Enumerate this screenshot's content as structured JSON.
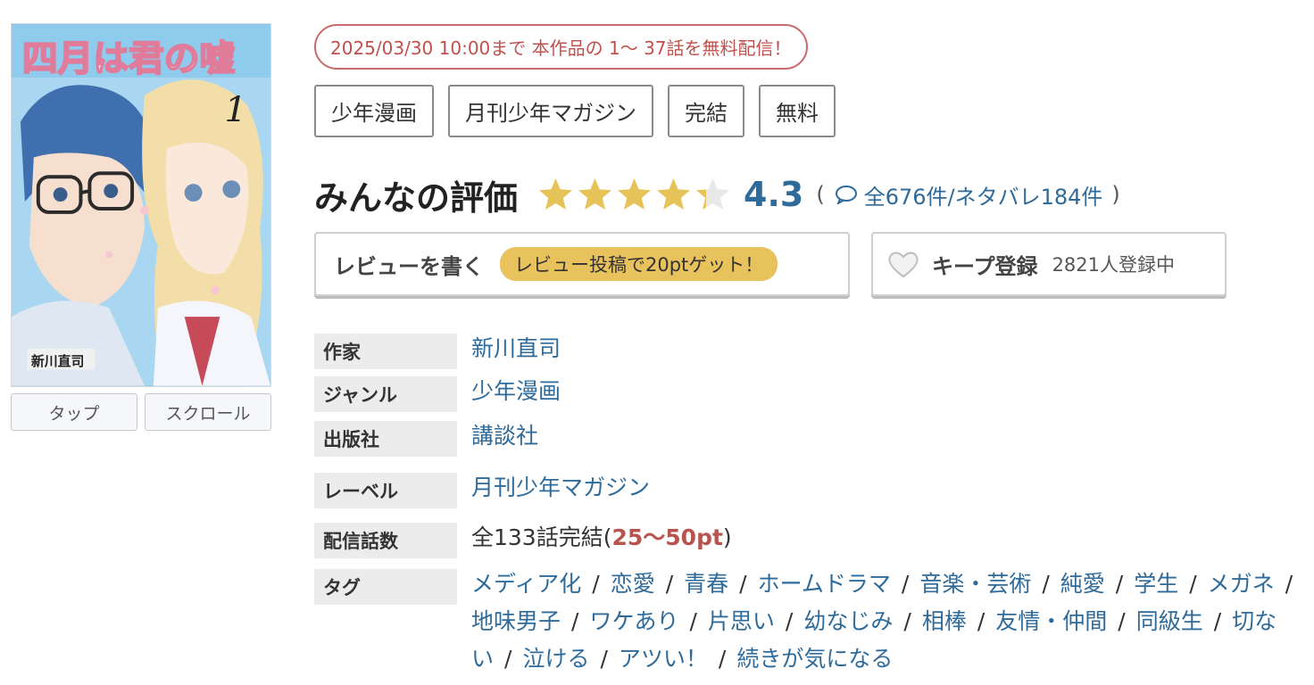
{
  "cover": {
    "alt": "四月は君の嘘 1",
    "title_art": "四月は君の嘘",
    "volume": "1",
    "author_on_cover": "新川直司"
  },
  "viewer_buttons": [
    "タップ",
    "スクロール"
  ],
  "promo_text": "2025/03/30 10:00まで 本作品の 1〜 37話を無料配信！",
  "genre_tags": [
    "少年漫画",
    "月刊少年マガジン",
    "完結",
    "無料"
  ],
  "rating": {
    "title": "みんなの評価",
    "score": "4.3",
    "stars_value": 4.3,
    "stars_max": 5,
    "paren_open": "(",
    "paren_close": ")",
    "review_count": "全676件/ネタバレ184件",
    "star_color": "#e6c358",
    "star_empty_color": "#e8e8e8"
  },
  "actions": {
    "review_label": "レビューを書く",
    "review_badge": "レビュー投稿で20ptゲット！",
    "keep_label": "キープ登録",
    "keep_count": "2821人登録中"
  },
  "details": {
    "author_label": "作家",
    "author": "新川直司",
    "genre_label": "ジャンル",
    "genre": "少年漫画",
    "publisher_label": "出版社",
    "publisher": "講談社",
    "label_label": "レーベル",
    "label": "月刊少年マガジン",
    "episodes_label": "配信話数",
    "episodes_prefix": "全133話完結(",
    "episodes_pt": "25〜50pt",
    "episodes_suffix": ")",
    "tags_label": "タグ",
    "tags": [
      "メディア化",
      "恋愛",
      "青春",
      "ホームドラマ",
      "音楽・芸術",
      "純愛",
      "学生",
      "メガネ",
      "地味男子",
      "ワケあり",
      "片思い",
      "幼なじみ",
      "相棒",
      "友情・仲間",
      "同級生",
      "切ない",
      "泣ける",
      "アツい！",
      "続きが気になる"
    ],
    "tag_separator": "/"
  },
  "colors": {
    "link": "#2f6b9a",
    "promo": "#c0504d",
    "badge": "#e8c25d"
  }
}
